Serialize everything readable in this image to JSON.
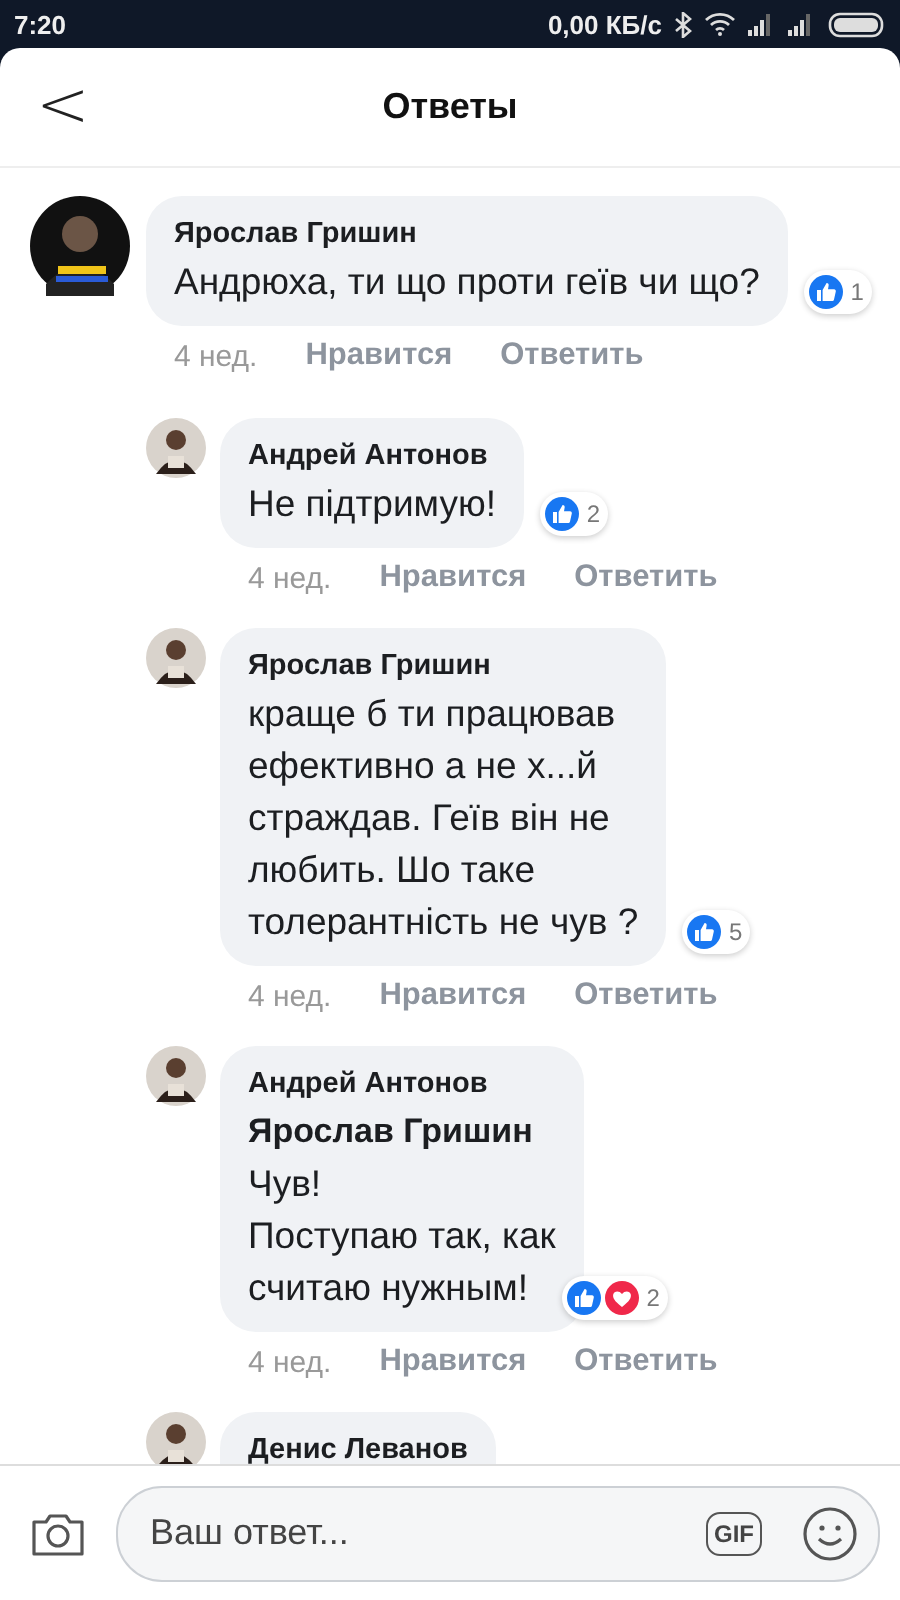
{
  "status_bar": {
    "time": "7:20",
    "speed": "0,00 КБ/с"
  },
  "header": {
    "title": "Ответы",
    "back": "<"
  },
  "comments": [
    {
      "author": "Ярослав Гришин",
      "text": "Андрюха, ти що проти геїв чи що?",
      "time": "4 нед.",
      "like": "Нравится",
      "reply": "Ответить",
      "reactions": {
        "icons": [
          {
            "kind": "like"
          }
        ],
        "count": "1"
      },
      "children": [
        {
          "author": "Андрей Антонов",
          "text": "Не підтримую!",
          "time": "4 нед.",
          "like": "Нравится",
          "reply": "Ответить",
          "reactions": {
            "icons": [
              {
                "kind": "like"
              }
            ],
            "count": "2"
          }
        },
        {
          "author": "Ярослав Гришин",
          "text": "краще б ти працював\nефективно а не х...й\nстраждав. Геїв він не\nлюбить. Шо таке\nтолерантність не чув ?",
          "time": "4 нед.",
          "like": "Нравится",
          "reply": "Ответить",
          "reactions": {
            "icons": [
              {
                "kind": "like"
              }
            ],
            "count": "5"
          }
        },
        {
          "author": "Андрей Антонов",
          "mention": "Ярослав Гришин",
          "text": "Чув!\nПоступаю так, как\nсчитаю нужным!",
          "time": "4 нед.",
          "like": "Нравится",
          "reply": "Ответить",
          "reactions": {
            "icons": [
              {
                "kind": "like"
              },
              {
                "kind": "love"
              }
            ],
            "count": "2"
          }
        },
        {
          "author": "Денис Леванов"
        }
      ]
    }
  ],
  "composer": {
    "placeholder": "Ваш ответ...",
    "gif": "GIF"
  }
}
